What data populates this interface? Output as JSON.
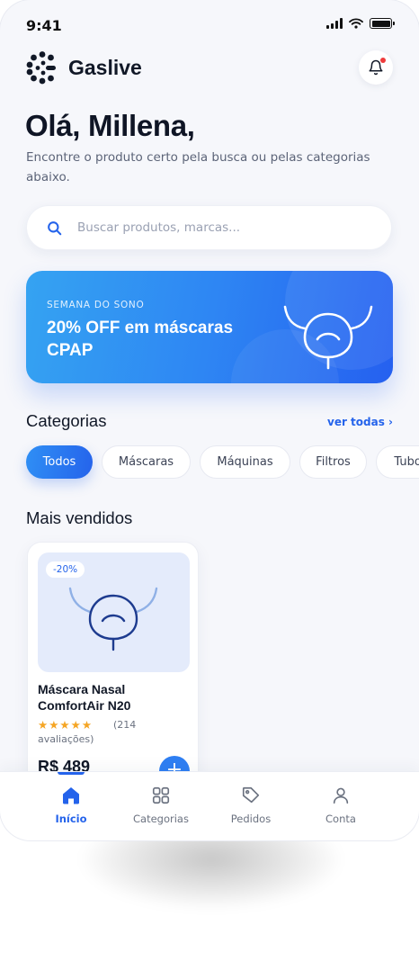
{
  "status_bar": {
    "time": "9:41"
  },
  "header": {
    "brand_name": "Gaslive",
    "logo_icon": "gaslive-logo-icon",
    "notification_icon": "bell-icon"
  },
  "greeting": {
    "title": "Olá, Millena,",
    "subtitle": "Encontre o produto certo pela busca ou pelas categorias abaixo."
  },
  "search": {
    "placeholder": "Buscar produtos, marcas..."
  },
  "banner": {
    "kicker": "SEMANA DO SONO",
    "title": "20% OFF em máscaras CPAP"
  },
  "categories": {
    "title": "Categorias",
    "see_all": "ver todas ›",
    "chips": [
      {
        "label": "Todos",
        "active": true
      },
      {
        "label": "Máscaras",
        "active": false
      },
      {
        "label": "Máquinas",
        "active": false
      },
      {
        "label": "Filtros",
        "active": false
      },
      {
        "label": "Tubos",
        "active": false
      }
    ]
  },
  "best_sellers": {
    "title": "Mais vendidos",
    "products": [
      {
        "badge": "-20%",
        "name": "Máscara Nasal ComfortAir N20",
        "stars": "★★★★★",
        "rating_count": "(214",
        "rating_label": "avaliações)",
        "price": "R$ 489",
        "add_label": "+"
      }
    ]
  },
  "bottom_nav": {
    "items": [
      {
        "label": "Início",
        "icon": "home-icon",
        "active": true
      },
      {
        "label": "Categorias",
        "icon": "grid-icon",
        "active": false
      },
      {
        "label": "Pedidos",
        "icon": "tag-icon",
        "active": false
      },
      {
        "label": "Conta",
        "icon": "user-icon",
        "active": false
      }
    ]
  },
  "colors": {
    "accent": "#2463eb",
    "background": "#f6f7fb",
    "star": "#f5a524"
  }
}
